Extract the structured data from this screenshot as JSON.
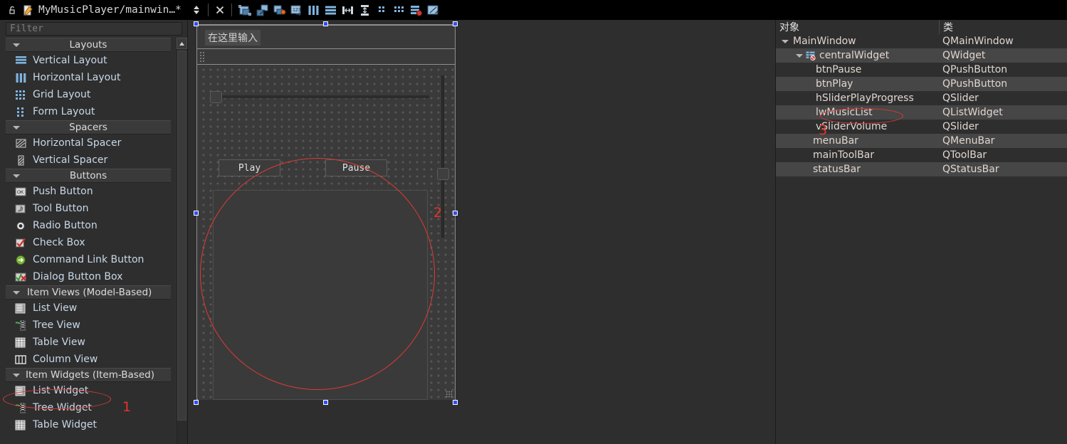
{
  "titlebar": {
    "lock_icon": "unlock-icon",
    "file_icon": "edit-file-icon",
    "title": "MyMusicPlayer/mainwin…*",
    "updown_icon": "updown-arrows-icon",
    "close_icon": "close-icon",
    "tools": [
      {
        "name": "edit-widgets-icon"
      },
      {
        "name": "edit-signals-slots-icon"
      },
      {
        "name": "edit-buddies-icon"
      },
      {
        "name": "edit-tab-order-icon"
      },
      {
        "name": "layout-horizontally-icon"
      },
      {
        "name": "layout-vertically-icon"
      },
      {
        "name": "layout-splitter-horizontal-icon"
      },
      {
        "name": "layout-splitter-vertical-icon"
      },
      {
        "name": "layout-form-icon"
      },
      {
        "name": "layout-grid-icon"
      },
      {
        "name": "break-layout-icon"
      },
      {
        "name": "adjust-size-icon"
      }
    ]
  },
  "widgetbox": {
    "filter_placeholder": "Filter",
    "scroll_up_icon": "scroll-up-arrow-icon",
    "groups": [
      {
        "title": "Layouts",
        "items": [
          {
            "label": "Vertical Layout",
            "icon": "vertical-layout-icon"
          },
          {
            "label": "Horizontal Layout",
            "icon": "horizontal-layout-icon"
          },
          {
            "label": "Grid Layout",
            "icon": "grid-layout-icon"
          },
          {
            "label": "Form Layout",
            "icon": "form-layout-icon"
          }
        ]
      },
      {
        "title": "Spacers",
        "items": [
          {
            "label": "Horizontal Spacer",
            "icon": "horizontal-spacer-icon"
          },
          {
            "label": "Vertical Spacer",
            "icon": "vertical-spacer-icon"
          }
        ]
      },
      {
        "title": "Buttons",
        "items": [
          {
            "label": "Push Button",
            "icon": "push-button-icon"
          },
          {
            "label": "Tool Button",
            "icon": "tool-button-icon"
          },
          {
            "label": "Radio Button",
            "icon": "radio-button-icon"
          },
          {
            "label": "Check Box",
            "icon": "check-box-icon"
          },
          {
            "label": "Command Link Button",
            "icon": "command-link-button-icon"
          },
          {
            "label": "Dialog Button Box",
            "icon": "dialog-button-box-icon"
          }
        ]
      },
      {
        "title": "Item Views (Model-Based)",
        "items": [
          {
            "label": "List View",
            "icon": "list-view-icon"
          },
          {
            "label": "Tree View",
            "icon": "tree-view-icon"
          },
          {
            "label": "Table View",
            "icon": "table-view-icon"
          },
          {
            "label": "Column View",
            "icon": "column-view-icon"
          }
        ]
      },
      {
        "title": "Item Widgets (Item-Based)",
        "items": [
          {
            "label": "List Widget",
            "icon": "list-widget-icon"
          },
          {
            "label": "Tree Widget",
            "icon": "tree-widget-icon"
          },
          {
            "label": "Table Widget",
            "icon": "table-widget-icon"
          }
        ]
      }
    ]
  },
  "form": {
    "menu_placeholder": "在这里输入",
    "btn_play": "Play",
    "btn_pause": "Pause",
    "slider_progress_name": "hSliderPlayProgress",
    "slider_volume_name": "vSliderVolume",
    "list_name": "lwMusicList"
  },
  "object_inspector": {
    "col_object": "对象",
    "col_class": "类",
    "rows": [
      {
        "name": "MainWindow",
        "cls": "QMainWindow",
        "indent": 0,
        "expander": true,
        "icon": ""
      },
      {
        "name": "centralWidget",
        "cls": "QWidget",
        "indent": 1,
        "expander": true,
        "icon": "central-widget-icon"
      },
      {
        "name": "btnPause",
        "cls": "QPushButton",
        "indent": 2,
        "expander": false,
        "icon": ""
      },
      {
        "name": "btnPlay",
        "cls": "QPushButton",
        "indent": 2,
        "expander": false,
        "icon": ""
      },
      {
        "name": "hSliderPlayProgress",
        "cls": "QSlider",
        "indent": 2,
        "expander": false,
        "icon": ""
      },
      {
        "name": "lwMusicList",
        "cls": "QListWidget",
        "indent": 2,
        "expander": false,
        "icon": ""
      },
      {
        "name": "vSliderVolume",
        "cls": "QSlider",
        "indent": 2,
        "expander": false,
        "icon": ""
      },
      {
        "name": "menuBar",
        "cls": "QMenuBar",
        "indent": 1,
        "expander": false,
        "icon": ""
      },
      {
        "name": "mainToolBar",
        "cls": "QToolBar",
        "indent": 1,
        "expander": false,
        "icon": ""
      },
      {
        "name": "statusBar",
        "cls": "QStatusBar",
        "indent": 1,
        "expander": false,
        "icon": ""
      }
    ]
  },
  "annotations": {
    "color": "#e8322c",
    "marks": [
      {
        "label": "1",
        "target": "List Widget"
      },
      {
        "label": "2",
        "target": "lwMusicList placed on form"
      },
      {
        "label": "3",
        "target": "lwMusicList in object inspector"
      }
    ]
  }
}
